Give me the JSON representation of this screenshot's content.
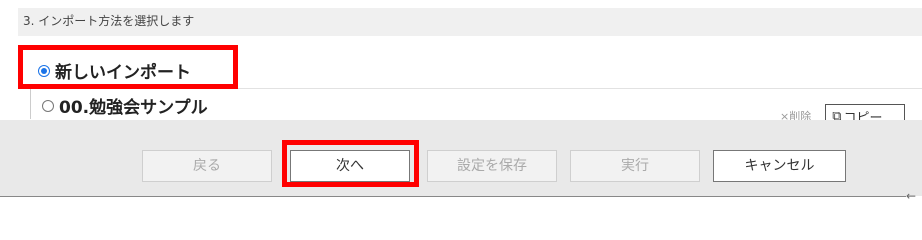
{
  "step": {
    "title": "3. インポート方法を選択します"
  },
  "options": [
    {
      "label": "新しいインポート",
      "selected": true
    },
    {
      "label": "00.勉強会サンプル",
      "selected": false
    }
  ],
  "row_actions": {
    "delete_label": "×削除",
    "copy_label": "コピー",
    "copy_icon": "copy-icon"
  },
  "footer": {
    "back_label": "戻る",
    "next_label": "次へ",
    "save_label": "設定を保存",
    "run_label": "実行",
    "cancel_label": "キャンセル"
  },
  "scroll": {
    "left_arrow": "←"
  },
  "colors": {
    "highlight": "#ff0000",
    "radio_selected": "#1a73e8",
    "footer_bg": "#e9e9e9",
    "header_bg": "#f0f0f0"
  }
}
